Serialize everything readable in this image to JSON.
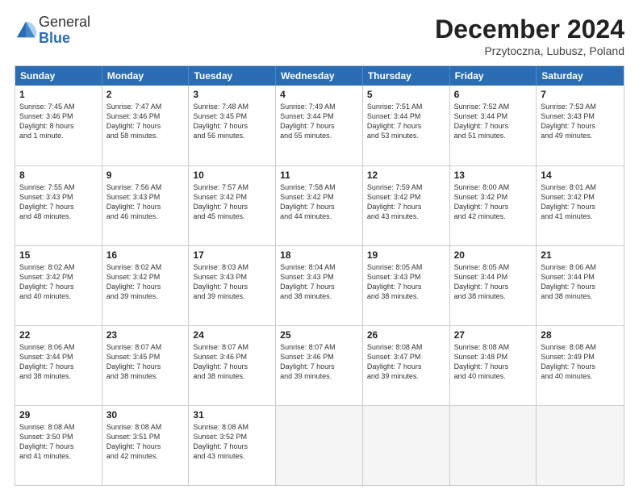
{
  "header": {
    "logo_general": "General",
    "logo_blue": "Blue",
    "month_title": "December 2024",
    "subtitle": "Przytoczna, Lubusz, Poland"
  },
  "days_of_week": [
    "Sunday",
    "Monday",
    "Tuesday",
    "Wednesday",
    "Thursday",
    "Friday",
    "Saturday"
  ],
  "rows": [
    [
      {
        "day": "1",
        "lines": [
          "Sunrise: 7:45 AM",
          "Sunset: 3:46 PM",
          "Daylight: 8 hours",
          "and 1 minute."
        ]
      },
      {
        "day": "2",
        "lines": [
          "Sunrise: 7:47 AM",
          "Sunset: 3:46 PM",
          "Daylight: 7 hours",
          "and 58 minutes."
        ]
      },
      {
        "day": "3",
        "lines": [
          "Sunrise: 7:48 AM",
          "Sunset: 3:45 PM",
          "Daylight: 7 hours",
          "and 56 minutes."
        ]
      },
      {
        "day": "4",
        "lines": [
          "Sunrise: 7:49 AM",
          "Sunset: 3:44 PM",
          "Daylight: 7 hours",
          "and 55 minutes."
        ]
      },
      {
        "day": "5",
        "lines": [
          "Sunrise: 7:51 AM",
          "Sunset: 3:44 PM",
          "Daylight: 7 hours",
          "and 53 minutes."
        ]
      },
      {
        "day": "6",
        "lines": [
          "Sunrise: 7:52 AM",
          "Sunset: 3:44 PM",
          "Daylight: 7 hours",
          "and 51 minutes."
        ]
      },
      {
        "day": "7",
        "lines": [
          "Sunrise: 7:53 AM",
          "Sunset: 3:43 PM",
          "Daylight: 7 hours",
          "and 49 minutes."
        ]
      }
    ],
    [
      {
        "day": "8",
        "lines": [
          "Sunrise: 7:55 AM",
          "Sunset: 3:43 PM",
          "Daylight: 7 hours",
          "and 48 minutes."
        ]
      },
      {
        "day": "9",
        "lines": [
          "Sunrise: 7:56 AM",
          "Sunset: 3:43 PM",
          "Daylight: 7 hours",
          "and 46 minutes."
        ]
      },
      {
        "day": "10",
        "lines": [
          "Sunrise: 7:57 AM",
          "Sunset: 3:42 PM",
          "Daylight: 7 hours",
          "and 45 minutes."
        ]
      },
      {
        "day": "11",
        "lines": [
          "Sunrise: 7:58 AM",
          "Sunset: 3:42 PM",
          "Daylight: 7 hours",
          "and 44 minutes."
        ]
      },
      {
        "day": "12",
        "lines": [
          "Sunrise: 7:59 AM",
          "Sunset: 3:42 PM",
          "Daylight: 7 hours",
          "and 43 minutes."
        ]
      },
      {
        "day": "13",
        "lines": [
          "Sunrise: 8:00 AM",
          "Sunset: 3:42 PM",
          "Daylight: 7 hours",
          "and 42 minutes."
        ]
      },
      {
        "day": "14",
        "lines": [
          "Sunrise: 8:01 AM",
          "Sunset: 3:42 PM",
          "Daylight: 7 hours",
          "and 41 minutes."
        ]
      }
    ],
    [
      {
        "day": "15",
        "lines": [
          "Sunrise: 8:02 AM",
          "Sunset: 3:42 PM",
          "Daylight: 7 hours",
          "and 40 minutes."
        ]
      },
      {
        "day": "16",
        "lines": [
          "Sunrise: 8:02 AM",
          "Sunset: 3:42 PM",
          "Daylight: 7 hours",
          "and 39 minutes."
        ]
      },
      {
        "day": "17",
        "lines": [
          "Sunrise: 8:03 AM",
          "Sunset: 3:43 PM",
          "Daylight: 7 hours",
          "and 39 minutes."
        ]
      },
      {
        "day": "18",
        "lines": [
          "Sunrise: 8:04 AM",
          "Sunset: 3:43 PM",
          "Daylight: 7 hours",
          "and 38 minutes."
        ]
      },
      {
        "day": "19",
        "lines": [
          "Sunrise: 8:05 AM",
          "Sunset: 3:43 PM",
          "Daylight: 7 hours",
          "and 38 minutes."
        ]
      },
      {
        "day": "20",
        "lines": [
          "Sunrise: 8:05 AM",
          "Sunset: 3:44 PM",
          "Daylight: 7 hours",
          "and 38 minutes."
        ]
      },
      {
        "day": "21",
        "lines": [
          "Sunrise: 8:06 AM",
          "Sunset: 3:44 PM",
          "Daylight: 7 hours",
          "and 38 minutes."
        ]
      }
    ],
    [
      {
        "day": "22",
        "lines": [
          "Sunrise: 8:06 AM",
          "Sunset: 3:44 PM",
          "Daylight: 7 hours",
          "and 38 minutes."
        ]
      },
      {
        "day": "23",
        "lines": [
          "Sunrise: 8:07 AM",
          "Sunset: 3:45 PM",
          "Daylight: 7 hours",
          "and 38 minutes."
        ]
      },
      {
        "day": "24",
        "lines": [
          "Sunrise: 8:07 AM",
          "Sunset: 3:46 PM",
          "Daylight: 7 hours",
          "and 38 minutes."
        ]
      },
      {
        "day": "25",
        "lines": [
          "Sunrise: 8:07 AM",
          "Sunset: 3:46 PM",
          "Daylight: 7 hours",
          "and 39 minutes."
        ]
      },
      {
        "day": "26",
        "lines": [
          "Sunrise: 8:08 AM",
          "Sunset: 3:47 PM",
          "Daylight: 7 hours",
          "and 39 minutes."
        ]
      },
      {
        "day": "27",
        "lines": [
          "Sunrise: 8:08 AM",
          "Sunset: 3:48 PM",
          "Daylight: 7 hours",
          "and 40 minutes."
        ]
      },
      {
        "day": "28",
        "lines": [
          "Sunrise: 8:08 AM",
          "Sunset: 3:49 PM",
          "Daylight: 7 hours",
          "and 40 minutes."
        ]
      }
    ],
    [
      {
        "day": "29",
        "lines": [
          "Sunrise: 8:08 AM",
          "Sunset: 3:50 PM",
          "Daylight: 7 hours",
          "and 41 minutes."
        ]
      },
      {
        "day": "30",
        "lines": [
          "Sunrise: 8:08 AM",
          "Sunset: 3:51 PM",
          "Daylight: 7 hours",
          "and 42 minutes."
        ]
      },
      {
        "day": "31",
        "lines": [
          "Sunrise: 8:08 AM",
          "Sunset: 3:52 PM",
          "Daylight: 7 hours",
          "and 43 minutes."
        ]
      },
      {
        "day": "",
        "lines": []
      },
      {
        "day": "",
        "lines": []
      },
      {
        "day": "",
        "lines": []
      },
      {
        "day": "",
        "lines": []
      }
    ]
  ]
}
